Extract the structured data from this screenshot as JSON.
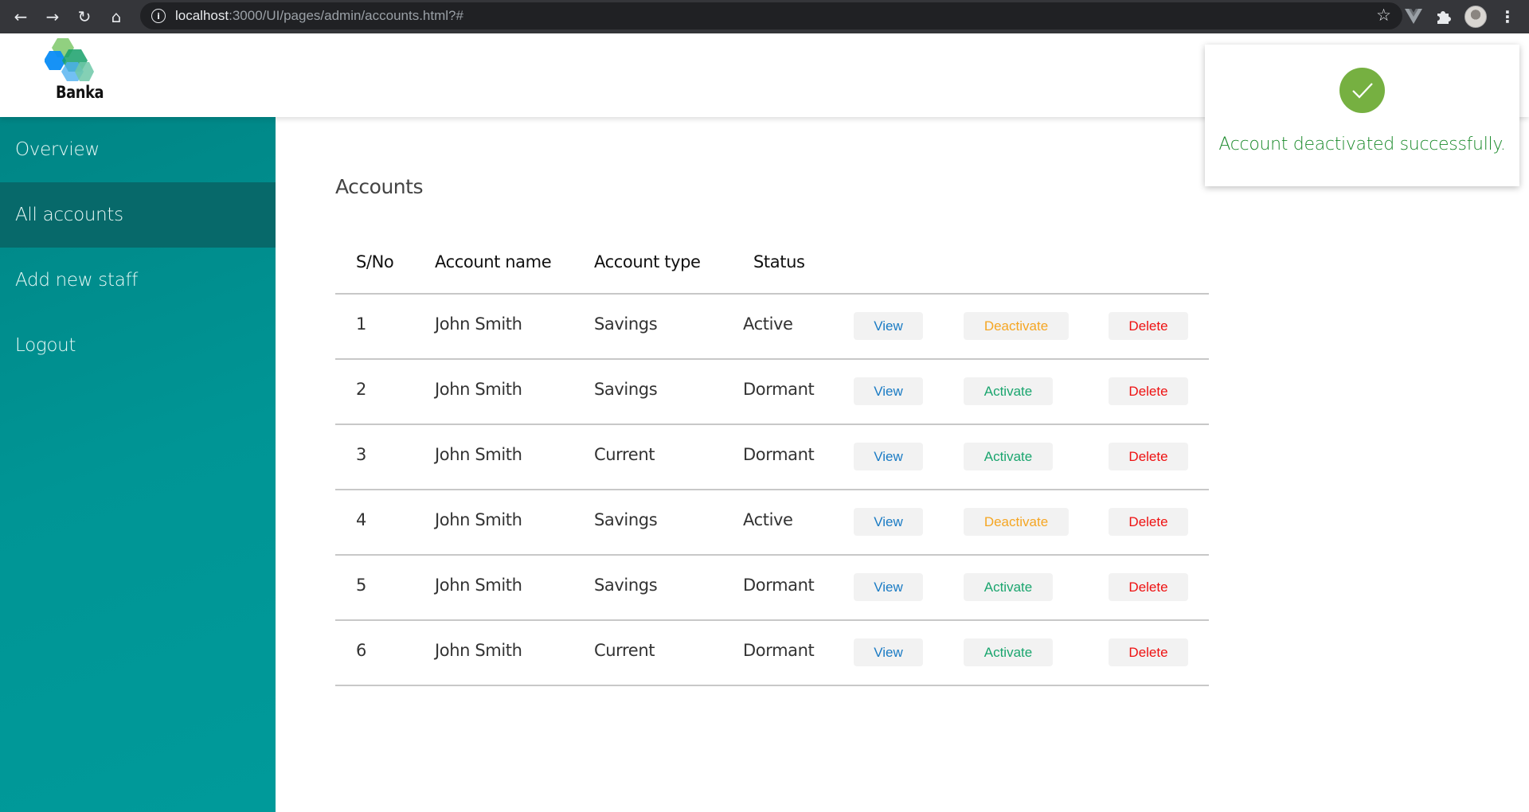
{
  "browser": {
    "url_host": "localhost",
    "url_rest": ":3000/UI/pages/admin/accounts.html?#",
    "back_icon": "←",
    "forward_icon": "→",
    "reload_icon": "↻",
    "home_icon": "⌂",
    "info_icon": "i",
    "star_icon": "☆",
    "menu_icon": "⋮"
  },
  "brand": {
    "name": "Banka"
  },
  "sidebar": {
    "items": [
      {
        "label": "Overview",
        "active": false
      },
      {
        "label": "All accounts",
        "active": true
      },
      {
        "label": "Add new staff",
        "active": false
      },
      {
        "label": "Logout",
        "active": false
      }
    ]
  },
  "main": {
    "title": "Accounts",
    "columns": [
      "S/No",
      "Account name",
      "Account type",
      "Status"
    ],
    "buttons": {
      "view": "View",
      "activate": "Activate",
      "deactivate": "Deactivate",
      "delete": "Delete"
    },
    "rows": [
      {
        "sno": "1",
        "name": "John Smith",
        "type": "Savings",
        "status": "Active",
        "toggle": "Deactivate"
      },
      {
        "sno": "2",
        "name": "John Smith",
        "type": "Savings",
        "status": "Dormant",
        "toggle": "Activate"
      },
      {
        "sno": "3",
        "name": "John Smith",
        "type": "Current",
        "status": "Dormant",
        "toggle": "Activate"
      },
      {
        "sno": "4",
        "name": "John Smith",
        "type": "Savings",
        "status": "Active",
        "toggle": "Deactivate"
      },
      {
        "sno": "5",
        "name": "John Smith",
        "type": "Savings",
        "status": "Dormant",
        "toggle": "Activate"
      },
      {
        "sno": "6",
        "name": "John Smith",
        "type": "Current",
        "status": "Dormant",
        "toggle": "Activate"
      }
    ]
  },
  "toast": {
    "message": "Account deactivated successfully.",
    "icon": "check-circle"
  },
  "colors": {
    "sidebar": "#008e8e",
    "sidebar_active": "#07696a",
    "view": "#1a7bc4",
    "activate": "#1aa56e",
    "deactivate": "#f5a623",
    "delete": "#ee1111",
    "success": "#76b041"
  }
}
